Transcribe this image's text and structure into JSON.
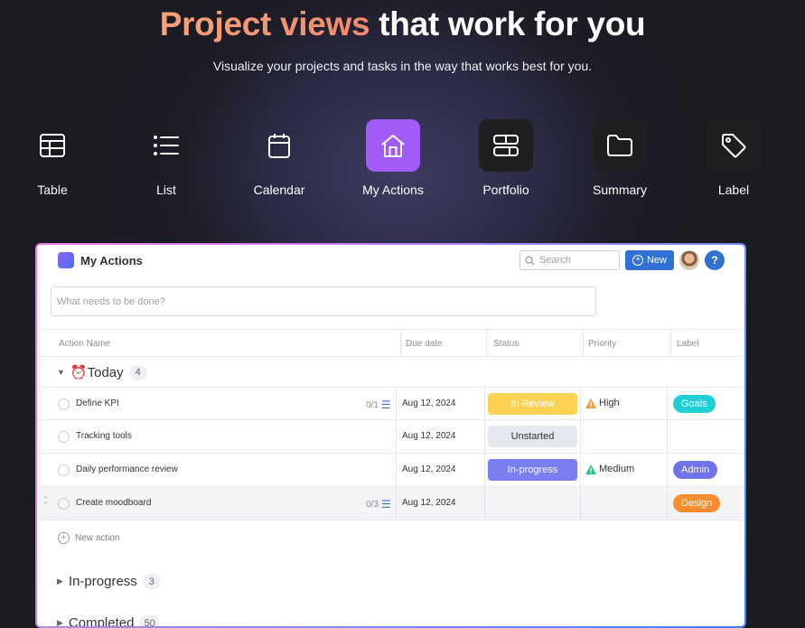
{
  "hero": {
    "title_accent": "Project views",
    "title_rest": "that work for you",
    "subtitle": "Visualize your projects and tasks in the way that works best for you."
  },
  "views": [
    {
      "label": "Table",
      "icon": "table-icon"
    },
    {
      "label": "List",
      "icon": "list-icon"
    },
    {
      "label": "Calendar",
      "icon": "calendar-icon"
    },
    {
      "label": "My Actions",
      "icon": "home-icon",
      "active": true
    },
    {
      "label": "Portfolio",
      "icon": "portfolio-icon"
    },
    {
      "label": "Summary",
      "icon": "folder-icon"
    },
    {
      "label": "Label",
      "icon": "tag-icon"
    }
  ],
  "app": {
    "title": "My Actions",
    "search_placeholder": "Search",
    "new_label": "New",
    "help_label": "?",
    "task_placeholder": "What needs to be done?",
    "columns": {
      "action": "Action Name",
      "due": "Due date",
      "status": "Status",
      "priority": "Priority",
      "label": "Label"
    },
    "groups": {
      "today": {
        "name": "⏰Today",
        "count": "4"
      },
      "inprogress": {
        "name": "In-progress",
        "count": "3"
      },
      "completed": {
        "name": "Completed",
        "count": "50"
      }
    },
    "rows": [
      {
        "name": "Define KPI",
        "subtasks": "0/1",
        "due": "Aug 12, 2024",
        "status": "In Review",
        "priority": "High",
        "label": "Goals"
      },
      {
        "name": "Tracking tools",
        "subtasks": "",
        "due": "Aug 12, 2024",
        "status": "Unstarted",
        "priority": "",
        "label": ""
      },
      {
        "name": "Daily performance review",
        "subtasks": "",
        "due": "Aug 12, 2024",
        "status": "In-progress",
        "priority": "Medium",
        "label": "Admin"
      },
      {
        "name": "Create moodboard",
        "subtasks": "0/3",
        "due": "Aug 12, 2024",
        "status": "",
        "priority": "",
        "label": "Design"
      }
    ],
    "new_action": "New action"
  },
  "colors": {
    "accent_purple": "#a25cf5",
    "primary_blue": "#3171d6",
    "in_review": "#fdd154",
    "unstarted": "#e5e8ef",
    "in_progress": "#7b7ef0",
    "goals": "#1ecfd6",
    "admin": "#6f72e8",
    "design": "#f68d2e"
  }
}
